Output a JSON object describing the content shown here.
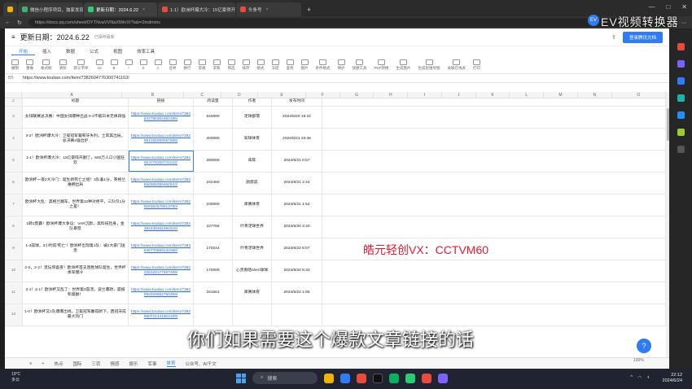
{
  "browser": {
    "tabs": [
      {
        "label": "",
        "color": "#f1b300"
      },
      {
        "label": "微信小程序项目，独家发现，已5",
        "color": "#3cb371"
      },
      {
        "label": "更新日期：2024.6.22",
        "color": "#2ecc71"
      },
      {
        "label": "1-1）欧洲杯爆大冷：15亿豪得开",
        "color": "#e84a3c"
      },
      {
        "label": "头条号",
        "color": "#e84a3c"
      }
    ],
    "url": "https://docs.qq.com/sheet/DYTNvaVVNaXlWnIX?tab=2mdmmc"
  },
  "doc": {
    "title": "更新日期：2024.6.22",
    "saved": "已保存最新",
    "login_label": "登录腾讯文档",
    "menus": [
      "开始",
      "插入",
      "数据",
      "公式",
      "视图",
      "效率工具"
    ],
    "active_menu": "开始",
    "toolbar": [
      "撤销",
      "重做",
      "格式刷",
      "清除",
      "默认字体",
      "10",
      "B",
      "I",
      "S",
      "A",
      "合并",
      "换行",
      "常规",
      "求和",
      "筛选",
      "排序",
      "格式",
      "冻结",
      "查找",
      "图片",
      "条件格式",
      "保护",
      "快捷工具",
      "PDF转换",
      "生成图片",
      "生成思维导图",
      "关联在线表",
      "打印"
    ],
    "cell_ref": "B5",
    "formula": "https://www.toutiao.com/item/7382604776300741163/"
  },
  "grid": {
    "columns": [
      "A",
      "B",
      "C",
      "D",
      "E",
      "F",
      "G",
      "H",
      "I",
      "J",
      "K",
      "L",
      "M",
      "N",
      "O"
    ],
    "header_row": [
      "标题",
      "链接",
      "阅读量",
      "作者",
      "发布时间"
    ],
    "rows": [
      {
        "n": "3",
        "title": "女排联赛总决赛：中国女排爆种出战 0-3不敌日本无缘四强",
        "link": "https://www.toutiao.com/item/7382642796362482195/",
        "reads": "640000",
        "author": "足球部落",
        "time": "2024/6/20 19:22"
      },
      {
        "n": "4",
        "title": "3-2！欧洲杯爆大冷：卫冕冠军葡萄牙失利，土耳其出局，总决赛4强出炉",
        "link": "https://www.toutiao.com/item/7382981255069057599/",
        "reads": "400000",
        "author": "知球体育",
        "time": "2024/6/21 23:46"
      },
      {
        "n": "5",
        "title": "1-1！欧洲杯爆大冷：15亿豪阵开翻了，600万人口小国狂欢",
        "link": "https://www.toutiao.com/item/7382604776300741163/",
        "reads": "280000",
        "author": "朱陈",
        "time": "2024/6/21 0:57"
      },
      {
        "n": "6",
        "title": "欧洲杯一夜2大冷门：诞生新死亡之组！3队着1分，英格兰难拥出局",
        "link": "https://www.toutiao.com/item/7382656565059462643/",
        "reads": "242450",
        "author": "颜愿兹",
        "time": "2024/6/21 2:44"
      },
      {
        "n": "7",
        "title": "欧洲杯大乱：黑格兰翻车，世界第32种对绝平，三队仅1分之差！",
        "link": "https://www.toutiao.com/item/7382608364578813750/",
        "reads": "230000",
        "author": "库赛体育",
        "time": "2024/6/21 1:54"
      },
      {
        "n": "8",
        "title": "1转2莫霸！欧洲杯爆大争议：VAR沉默，黑料技险身，金队暴怒",
        "link": "https://www.toutiao.com/item/7382284439461691916/",
        "reads": "227755",
        "author": "叶青足球世界",
        "time": "2024/6/20 2:40"
      },
      {
        "n": "9",
        "title": "1-3崩球，3小时前'死亡'！欧洲杯出现第1队：被2大豪门送走",
        "link": "https://www.toutiao.com/item/7383846770669142068/",
        "reads": "170244",
        "author": "叶青足球世界",
        "time": "2024/6/22 5:07"
      },
      {
        "n": "10",
        "title": "2-0，2-2！足坛惊喜夜！欧洲杯首支连胜球队诞生，世界杯季军爆冷",
        "link": "https://www.toutiao.com/item/7382336328177657498/",
        "reads": "170000",
        "author": "心灵看哈shen球球",
        "time": "2024/6/20 5:33"
      },
      {
        "n": "11",
        "title": "2-1！3-1！欧洲杯又乱了：世界第3崩溃，波兰遭政，晨报和第群！",
        "link": "https://www.toutiao.com/item/7382992929952760359/",
        "reads": "161561",
        "author": "库赛体育",
        "time": "2024/6/22 1:55"
      },
      {
        "n": "12",
        "title": "1-0！欧洲杯又1队爆爆出线，卫冕冠军赢得新下，西班牙成最大热门",
        "link": "https://www.toutiao.com/item/7382660721441604109/",
        "reads": "",
        "author": "",
        "time": ""
      }
    ]
  },
  "sheet_tabs": [
    "热点",
    "国际",
    "三农",
    "情感",
    "娱乐",
    "军事",
    "体育",
    "公众号、AI千文"
  ],
  "active_sheet": "体育",
  "overlay": {
    "watermark": "EV视频转换器",
    "watermark_badge": "EV",
    "red_text": "皓元轻创VX：CCTVM60",
    "subtitle": "你们如果需要这个爆款文章链接的话",
    "help": "?",
    "zoom": "100%"
  },
  "taskbar": {
    "weather_temp": "19°C",
    "weather_desc": "多云",
    "search": "搜索",
    "time": "22:12",
    "date": "2024/6/24"
  }
}
